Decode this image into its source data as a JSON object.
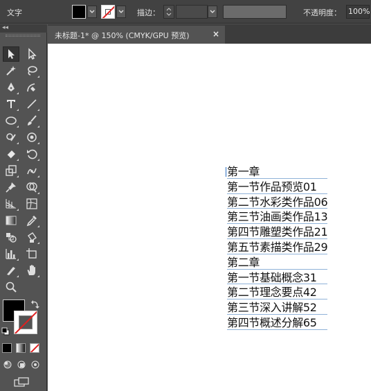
{
  "control_bar": {
    "tool_name": "文字",
    "stroke_label": "描边：",
    "opacity_label": "不透明度：",
    "opacity_value": "100%",
    "fill_color": "#000000",
    "stroke_color": "none"
  },
  "document_tab": {
    "title": "未标题-1* @ 150% (CMYK/GPU 预览)",
    "close": "×"
  },
  "tools": [
    "selection-tool",
    "direct-selection-tool",
    "magic-wand-tool",
    "lasso-tool",
    "pen-tool",
    "curvature-tool",
    "type-tool",
    "line-segment-tool",
    "ellipse-tool",
    "paintbrush-tool",
    "shaper-tool",
    "blob-brush-tool",
    "eraser-tool",
    "rotate-tool",
    "scale-tool",
    "puppet-warp-tool",
    "pin-tool",
    "shape-builder-tool",
    "perspective-grid-tool",
    "mesh-tool",
    "gradient-tool",
    "eyedropper-tool",
    "blend-tool",
    "live-paint-bucket-tool",
    "column-graph-tool",
    "artboard-tool",
    "slice-tool",
    "hand-tool",
    "zoom-tool"
  ],
  "canvas_text": [
    "第一章",
    "第一节作品预览01",
    "第二节水彩类作品06",
    "第三节油画类作品13",
    "第四节雕塑类作品21",
    "第五节素描类作品29",
    "第二章",
    "第一节基础概念31",
    "第二节理念要点42",
    "第三节深入讲解52",
    "第四节概述分解65"
  ]
}
